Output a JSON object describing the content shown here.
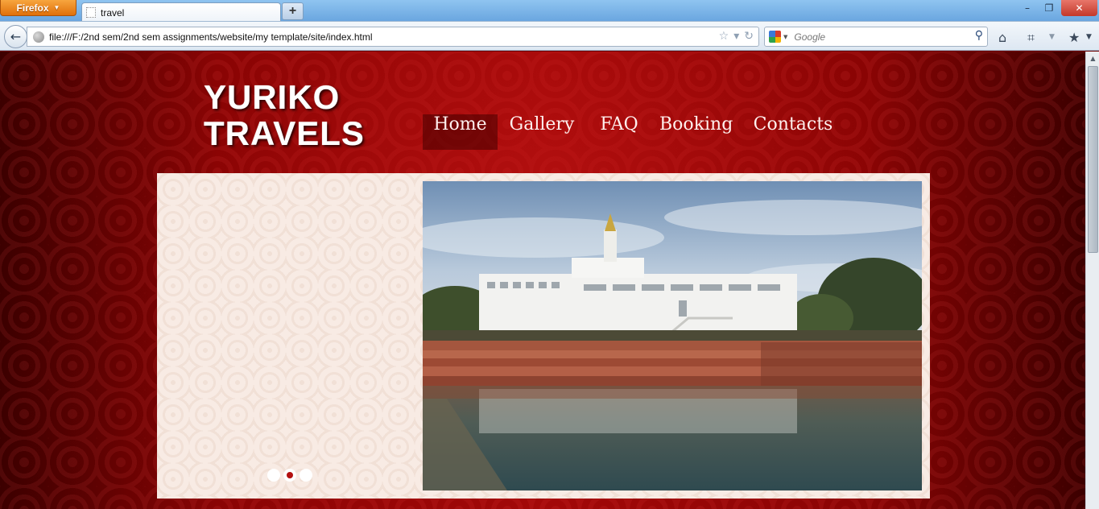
{
  "browser": {
    "app_button": "Firefox",
    "tab_title": "travel",
    "new_tab": "+",
    "window_controls": {
      "minimize": "–",
      "maximize": "❐",
      "close": "✕"
    },
    "url": "file:///F:/2nd sem/2nd sem assignments/website/my template/site/index.html",
    "search_placeholder": "Google"
  },
  "site": {
    "logo": [
      "YURIKO",
      "TRAVELS"
    ],
    "menu": [
      "Home",
      "Gallery",
      "FAQ",
      "Booking",
      "Contacts"
    ],
    "active_menu": "Home",
    "slider": {
      "dot_count": 3,
      "active_dot": 1
    },
    "colors": {
      "background": "#8a0404",
      "panel": "#f8ebe4",
      "accent_dot": "#b31010"
    }
  }
}
